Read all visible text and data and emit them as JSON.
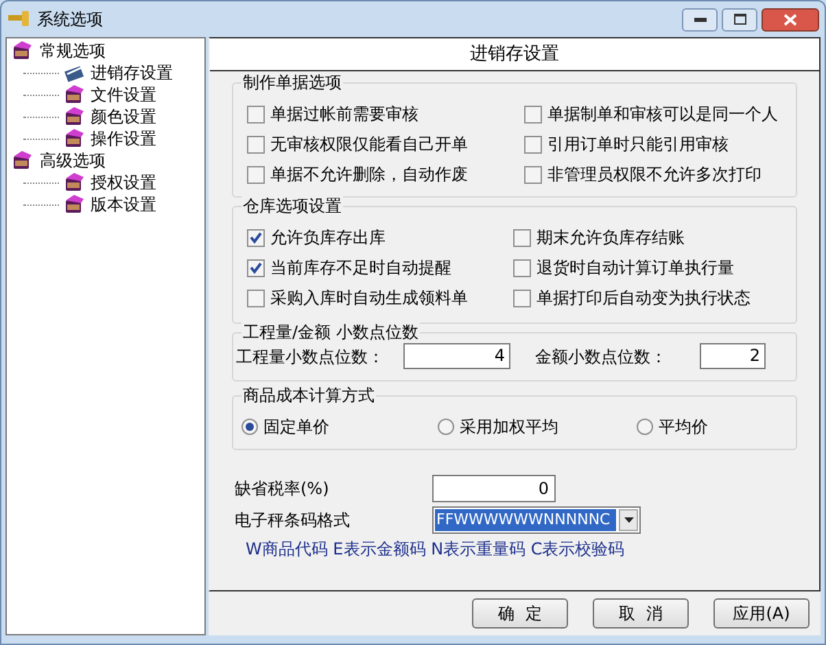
{
  "window": {
    "title": "系统选项"
  },
  "tree": [
    {
      "label": "常规选项",
      "selected": false,
      "children": [
        {
          "label": "进销存设置",
          "selected": true
        },
        {
          "label": "文件设置",
          "selected": false
        },
        {
          "label": "颜色设置",
          "selected": false
        },
        {
          "label": "操作设置",
          "selected": false
        }
      ]
    },
    {
      "label": "高级选项",
      "selected": false,
      "children": [
        {
          "label": "授权设置",
          "selected": false
        },
        {
          "label": "版本设置",
          "selected": false
        }
      ]
    }
  ],
  "panel_title": "进销存设置",
  "document_options": {
    "title": "制作单据选项",
    "options": [
      {
        "label": "单据过帐前需要审核",
        "checked": false
      },
      {
        "label": "单据制单和审核可以是同一个人",
        "checked": false
      },
      {
        "label": "无审核权限仅能看自己开单",
        "checked": false
      },
      {
        "label": "引用订单时只能引用审核",
        "checked": false
      },
      {
        "label": "单据不允许删除，自动作废",
        "checked": false
      },
      {
        "label": "非管理员权限不允许多次打印",
        "checked": false
      }
    ]
  },
  "warehouse_options": {
    "title": "仓库选项设置",
    "options": [
      {
        "label": "允许负库存出库",
        "checked": true
      },
      {
        "label": "期末允许负库存结账",
        "checked": false
      },
      {
        "label": "当前库存不足时自动提醒",
        "checked": true
      },
      {
        "label": "退货时自动计算订单执行量",
        "checked": false
      },
      {
        "label": "采购入库时自动生成领料单",
        "checked": false
      },
      {
        "label": "单据打印后自动变为执行状态",
        "checked": false
      }
    ]
  },
  "decimals": {
    "title": "工程量/金额  小数点位数",
    "quantity_label": "工程量小数点位数：",
    "quantity_value": "4",
    "amount_label": "金额小数点位数：",
    "amount_value": "2"
  },
  "cost_method": {
    "title": "商品成本计算方式",
    "options": [
      {
        "label": "固定单价",
        "selected": true
      },
      {
        "label": "采用加权平均",
        "selected": false
      },
      {
        "label": "平均价",
        "selected": false
      }
    ]
  },
  "tax_rate": {
    "label": "缺省税率(%)",
    "value": "0"
  },
  "barcode_format": {
    "label": "电子秤条码格式",
    "value": "FFWWWWWWNNNNNC",
    "hint": "W商品代码 E表示金额码 N表示重量码 C表示校验码"
  },
  "buttons": [
    "确  定",
    "取  消",
    "应用(A)"
  ]
}
